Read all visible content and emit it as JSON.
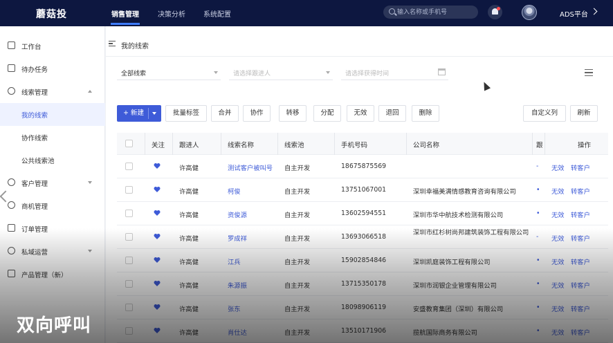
{
  "topbar": {
    "logo": "蘑菇投",
    "tabs": [
      "销售管理",
      "决策分析",
      "系统配置"
    ],
    "search_placeholder": "输入名称或手机号",
    "platform": "ADS平台"
  },
  "sidebar": {
    "items": [
      {
        "label": "工作台",
        "icon": "dashboard-icon"
      },
      {
        "label": "待办任务",
        "icon": "task-icon"
      },
      {
        "label": "线索管理",
        "icon": "clue-icon"
      },
      {
        "label": "我的线索",
        "icon": ""
      },
      {
        "label": "协作线索",
        "icon": ""
      },
      {
        "label": "公共线索池",
        "icon": ""
      },
      {
        "label": "客户管理",
        "icon": "customer-icon"
      },
      {
        "label": "商机管理",
        "icon": "opportunity-icon"
      },
      {
        "label": "订单管理",
        "icon": "order-icon"
      },
      {
        "label": "私域运营",
        "icon": "private-domain-icon"
      },
      {
        "label": "产品管理（新）",
        "icon": "product-icon"
      }
    ]
  },
  "page": {
    "title": "我的线索",
    "filters": {
      "scope": "全部线索",
      "follower_placeholder": "请选择跟进人",
      "time_placeholder": "请选择获得时间"
    },
    "toolbar": {
      "new": "+ 新建",
      "buttons": [
        "批量标签",
        "合并",
        "协作",
        "转移",
        "分配",
        "无效",
        "退回",
        "删除"
      ],
      "custom_columns": "自定义列",
      "refresh": "刷新"
    },
    "table": {
      "headers": [
        "关注",
        "跟进人",
        "线索名称",
        "线索池",
        "手机号码",
        "公司名称",
        "跟",
        "操作"
      ],
      "rows": [
        {
          "follower": "许高健",
          "name": "测试客户被叫号",
          "pool": "自主开发",
          "phone": "18675875569",
          "company": "",
          "mark": "-"
        },
        {
          "follower": "许高健",
          "name": "柯俊",
          "pool": "自主开发",
          "phone": "13751067001",
          "company": "深圳幸福美满情感教育咨询有限公司",
          "mark": "•"
        },
        {
          "follower": "许高健",
          "name": "资俊源",
          "pool": "自主开发",
          "phone": "13602594551",
          "company": "深圳市华中航技术检测有限公司",
          "mark": "•"
        },
        {
          "follower": "许高健",
          "name": "罗成祥",
          "pool": "自主开发",
          "phone": "13693066518",
          "company": "深圳市红杉树尚邦建筑装饰工程有限公司",
          "mark": "-"
        },
        {
          "follower": "许高健",
          "name": "江兵",
          "pool": "自主开发",
          "phone": "15902854846",
          "company": "深圳凯庭装饰工程有限公司",
          "mark": "•"
        },
        {
          "follower": "许高健",
          "name": "朱源振",
          "pool": "自主开发",
          "phone": "13715350178",
          "company": "深圳市润银企业管理有限公司",
          "mark": "•"
        },
        {
          "follower": "许高健",
          "name": "张东",
          "pool": "自主开发",
          "phone": "18098906119",
          "company": "安盛教育集团（深圳）有限公司",
          "mark": "•"
        },
        {
          "follower": "许高健",
          "name": "肖仕达",
          "pool": "自主开发",
          "phone": "13510171906",
          "company": "揽航国际商务有限公司",
          "mark": "•"
        }
      ],
      "actions": [
        "无效",
        "转客户"
      ]
    }
  },
  "caption": "双向呼叫",
  "colors": {
    "nav_bg": "#0d1740",
    "accent": "#3e5bd8"
  }
}
